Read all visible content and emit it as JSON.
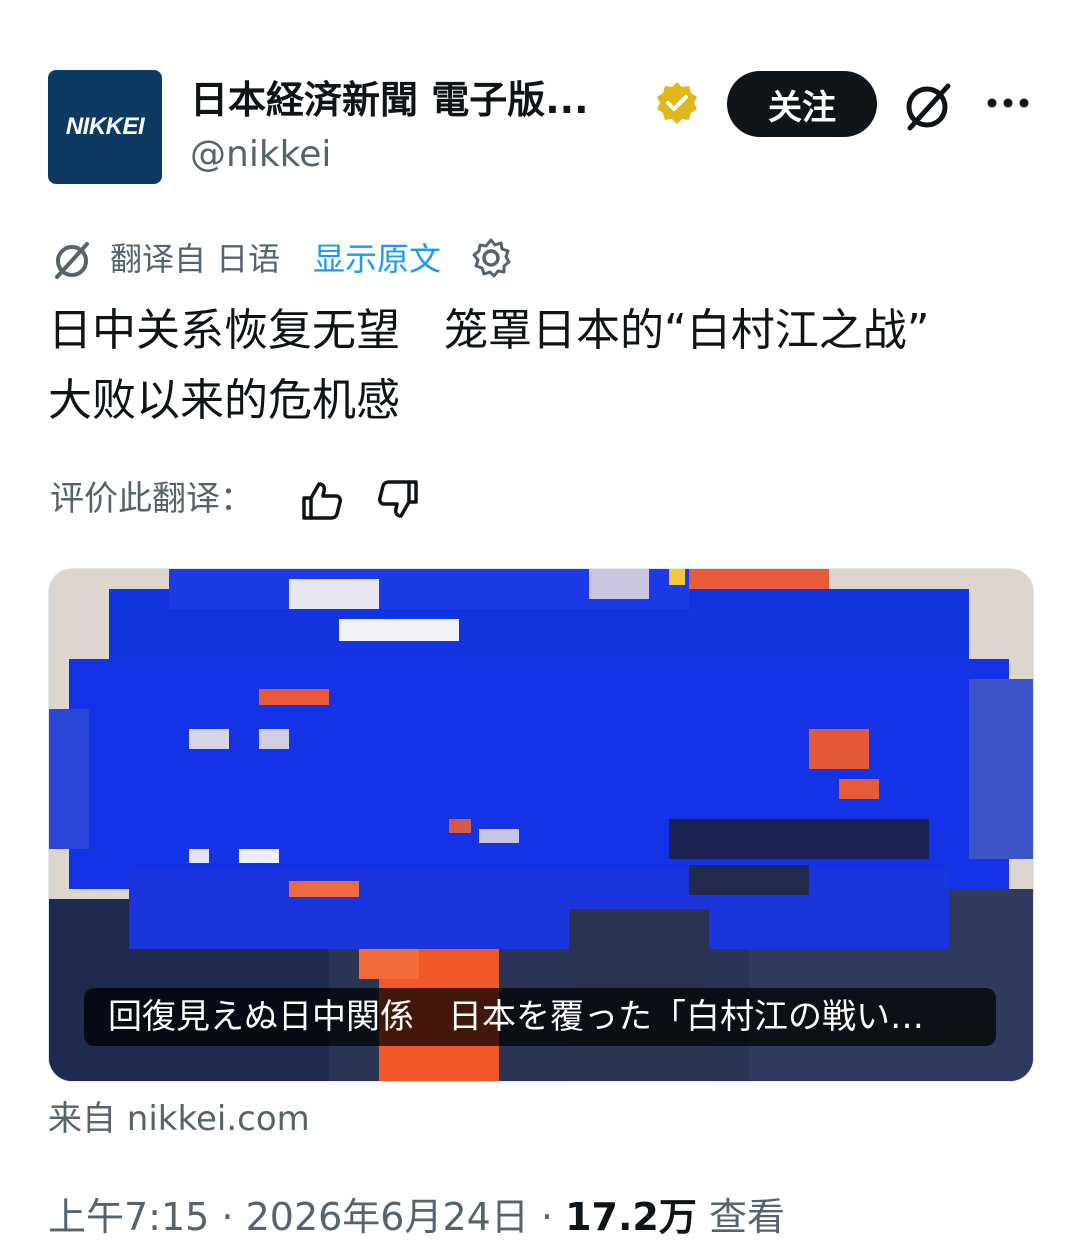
{
  "account": {
    "avatar_text": "NIKKEI",
    "display_name": "日本経済新聞 電子版...",
    "handle": "@nikkei",
    "follow_label": "关注"
  },
  "icons": {
    "verified": "verified-badge-icon",
    "grok": "grok-icon",
    "more": "more-icon",
    "translate": "translate-icon",
    "settings": "gear-icon",
    "like": "thumb-up-icon",
    "dislike": "thumb-down-icon"
  },
  "translation": {
    "label": "翻译自 日语",
    "show_original": "显示原文",
    "rate_label": "评价此翻译："
  },
  "post": {
    "line1": "日中关系恢复无望　笼罩日本的“白村江之战”",
    "line2": "大败以来的危机感"
  },
  "card": {
    "caption": "回復見えぬ日中関係　日本を覆った「白村江の戦い…",
    "source": "来自 nikkei.com"
  },
  "meta": {
    "time": "上午7:15",
    "separator": " · ",
    "date": "2026年6月24日",
    "views": "17.2万",
    "views_label": "查看"
  },
  "colors": {
    "accent": "#1d9bf0",
    "text": "#0f1419",
    "muted": "#536471",
    "verified_gold": "#e2b719",
    "avatar_bg": "#0d3a63"
  }
}
